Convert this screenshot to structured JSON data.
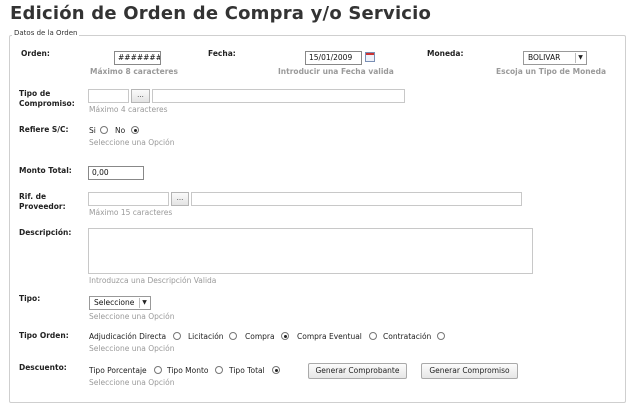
{
  "page_title": "Edición de Orden de Compra y/o Servicio",
  "fieldset_legend": "Datos de la Orden",
  "orden": {
    "label": "Orden:",
    "value": "#######",
    "hint": "Máximo 8 caracteres"
  },
  "fecha": {
    "label": "Fecha:",
    "value": "15/01/2009",
    "hint": "Introducir una Fecha valida"
  },
  "moneda": {
    "label": "Moneda:",
    "selected": "BOLIVAR",
    "hint": "Escoja un Tipo de Moneda"
  },
  "tipo_compromiso": {
    "label": "Tipo de Compromiso:",
    "lookup_label": "...",
    "hint": "Máximo 4 caracteres"
  },
  "refiere_sc": {
    "label": "Refiere S/C:",
    "opt_si": "Si",
    "opt_no": "No",
    "selected": "No",
    "hint": "Seleccione una Opción"
  },
  "monto_total": {
    "label": "Monto Total:",
    "value": "0,00"
  },
  "rif_proveedor": {
    "label": "Rif. de Proveedor:",
    "lookup_label": "...",
    "hint": "Máximo 15 caracteres"
  },
  "descripcion": {
    "label": "Descripción:",
    "hint": "Introduzca una Descripción Valida"
  },
  "tipo": {
    "label": "Tipo:",
    "selected": "Seleccione",
    "hint": "Seleccione una Opción"
  },
  "tipo_orden": {
    "label": "Tipo Orden:",
    "options": [
      "Adjudicación Directa",
      "Licitación",
      "Compra",
      "Compra Eventual",
      "Contratación"
    ],
    "selected": "Compra",
    "hint": "Seleccione una Opción"
  },
  "descuento": {
    "label": "Descuento:",
    "options": [
      "Tipo Porcentaje",
      "Tipo Monto",
      "Tipo Total"
    ],
    "selected": "Tipo Total",
    "hint": "Seleccione una Opción"
  },
  "buttons": {
    "generar_comprobante": "Generar Comprobante",
    "generar_compromiso": "Generar Compromiso"
  },
  "icons": {
    "calendar": "calendar-icon",
    "dropdown": "chevron-down-icon"
  }
}
